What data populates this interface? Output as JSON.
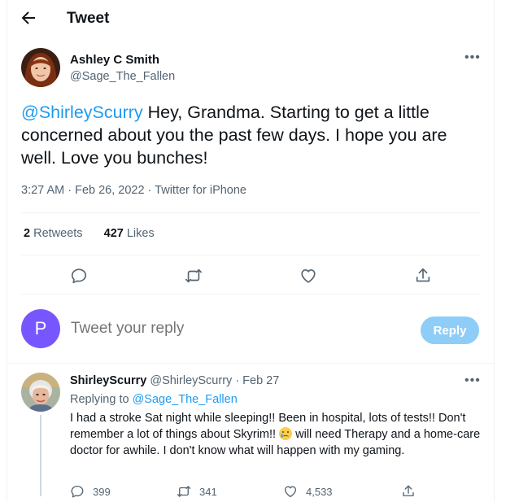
{
  "header": {
    "title": "Tweet"
  },
  "tweet": {
    "author_name": "Ashley C Smith",
    "author_handle": "@Sage_The_Fallen",
    "more": "•••",
    "mention": "@ShirleyScurry",
    "text": " Hey, Grandma. Starting to get a little concerned about you the past few days. I hope you are well. Love you bunches!",
    "meta": "3:27 AM · Feb 26, 2022 · Twitter for iPhone",
    "retweets_count": "2",
    "retweets_label": "Retweets",
    "likes_count": "427",
    "likes_label": "Likes"
  },
  "compose": {
    "avatar_letter": "P",
    "placeholder": "Tweet your reply",
    "button_label": "Reply"
  },
  "reply": {
    "author_name": "ShirleyScurry",
    "author_handle": "@ShirleyScurry",
    "date": "· Feb 27",
    "more": "•••",
    "replying_prefix": "Replying to",
    "replying_to": "@Sage_The_Fallen",
    "text_before_emoji": "I had a stroke Sat night while sleeping!!  Been in hospital, lots of tests!! Don't remember a lot of things about Skyrim!!",
    "text_after_emoji": "  will need Therapy and a home-care doctor for awhile.  I don't know what will happen with my gaming.",
    "reply_count": "399",
    "retweet_count": "341",
    "like_count": "4,533"
  },
  "colors": {
    "accent": "#1d9bf0",
    "reply_button": "#8ecdf8",
    "avatar_p": "#7856ff"
  },
  "icons": [
    "back-arrow-icon",
    "reply-icon",
    "retweet-icon",
    "like-icon",
    "share-icon"
  ]
}
